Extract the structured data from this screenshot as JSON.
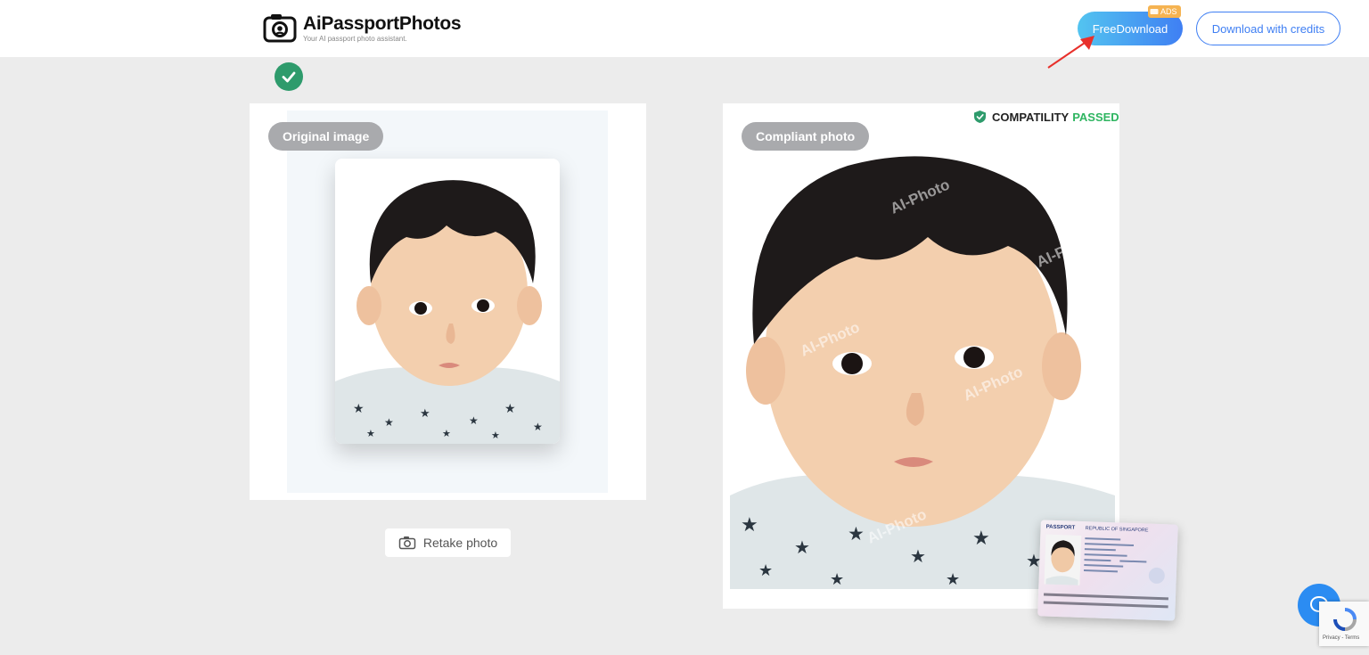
{
  "header": {
    "brand_name": "AiPassportPhotos",
    "brand_tagline": "Your AI passport photo assistant.",
    "free_download_label": "FreeDownload",
    "ads_badge": "ADS",
    "credits_label": "Download with credits"
  },
  "left_panel": {
    "tag": "Original image",
    "retake_label": "Retake photo"
  },
  "right_panel": {
    "tag": "Compliant photo",
    "compat_label": "COMPATILITY",
    "compat_status": "PASSED",
    "watermark": "AI-Photo",
    "passport_title": "PASSPORT",
    "passport_country": "REPUBLIC OF SINGAPORE"
  },
  "recaptcha": {
    "text": "Privacy - Terms"
  },
  "colors": {
    "accent_blue": "#3f7ff3",
    "gradient_start": "#53c4f0",
    "passed_green": "#2fb561",
    "check_green": "#2e9b6c",
    "ads_orange": "#f5b351",
    "tag_gray": "#a9aaad"
  }
}
